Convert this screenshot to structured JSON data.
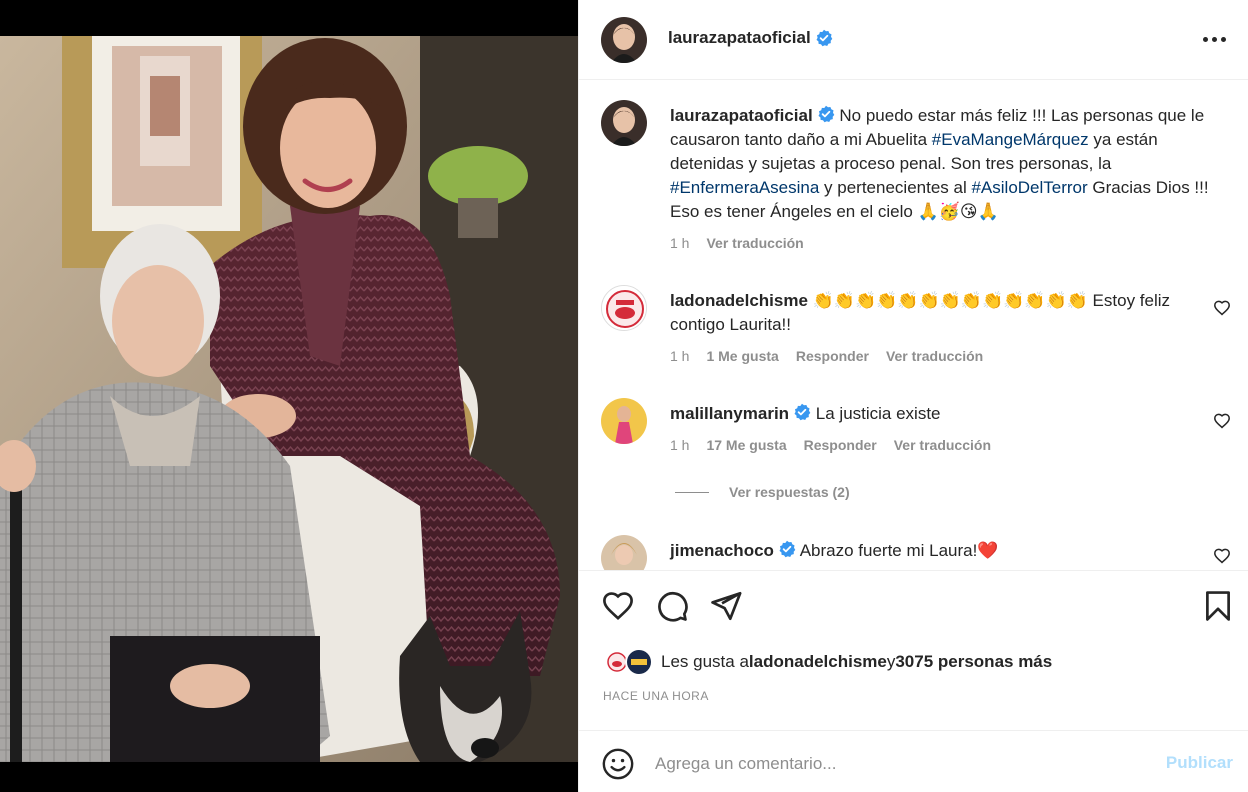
{
  "post": {
    "author": "laurazapataoficial",
    "verified": true,
    "image_alt": ""
  },
  "caption": {
    "username": "laurazapataoficial",
    "part1": " No puedo estar más feliz !!! Las personas que le causaron tanto daño a mi Abuelita ",
    "tag1": "#EvaMangeMárquez",
    "part2": " ya están detenidas y sujetas a proceso penal. Son tres personas, la ",
    "tag2": "#EnfermeraAsesina",
    "part3": " y pertenecientes al ",
    "tag3": "#AsiloDelTerror",
    "part4": " Gracias Dios !!! Eso es tener Ángeles en el cielo 🙏🥳😘🙏",
    "time": "1 h",
    "translate": "Ver traducción"
  },
  "comments": [
    {
      "username": "ladonadelchisme",
      "verified": false,
      "text": " 👏👏👏👏👏👏👏👏👏👏👏👏👏 Estoy feliz contigo Laurita!!",
      "time": "1 h",
      "likes": "1 Me gusta",
      "reply": "Responder",
      "translate": "Ver traducción"
    },
    {
      "username": "malillanymarin",
      "verified": true,
      "text": " La justicia existe",
      "time": "1 h",
      "likes": "17 Me gusta",
      "reply": "Responder",
      "translate": "Ver traducción",
      "view_replies": "Ver respuestas (2)"
    },
    {
      "username": "jimenachoco",
      "verified": true,
      "text": " Abrazo fuerte mi Laura!❤️"
    }
  ],
  "likes": {
    "prefix": "Les gusta a ",
    "user": "ladonadelchisme",
    "middle": " y ",
    "count": "3075 personas más"
  },
  "time_ago": "HACE UNA HORA",
  "comment_box": {
    "placeholder": "Agrega un comentario...",
    "publish": "Publicar"
  },
  "colors": {
    "verified": "#3897f0",
    "hashtag": "#00376b",
    "publish_disabled": "#b2dffc"
  }
}
